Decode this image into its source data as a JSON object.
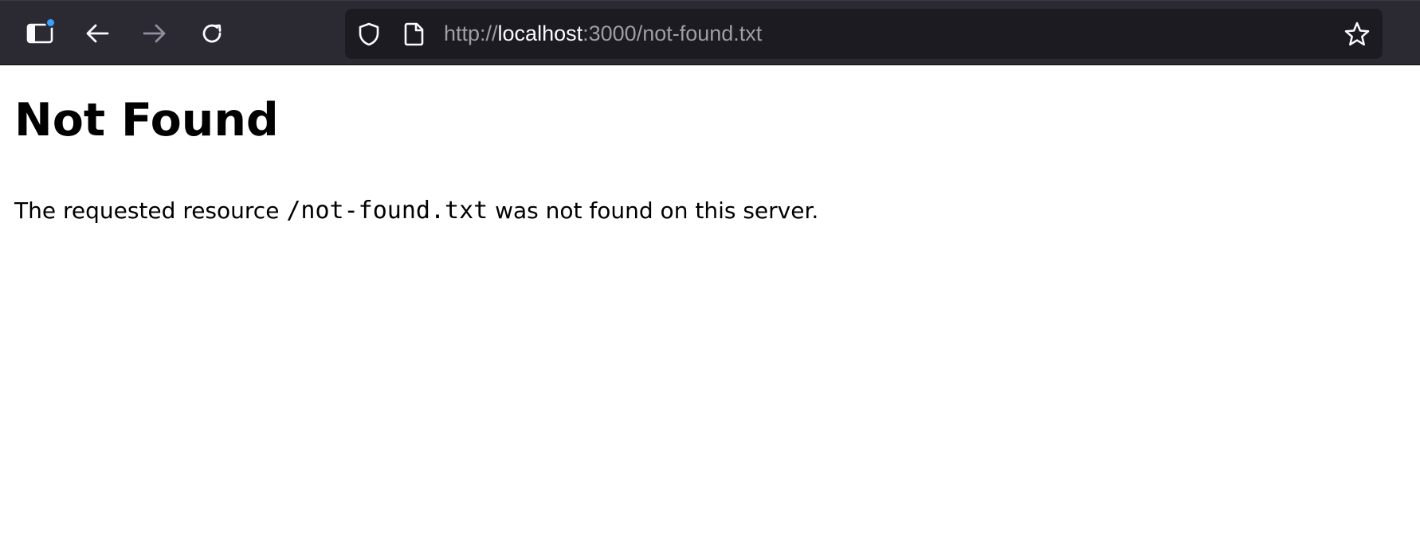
{
  "browser": {
    "url": {
      "scheme": "http://",
      "host": "localhost",
      "rest": ":3000/not-found.txt"
    },
    "icons": {
      "sidebar": "sidebar-icon",
      "back": "arrow-left-icon",
      "forward": "arrow-right-icon",
      "reload": "reload-icon",
      "shield": "shield-icon",
      "page": "page-icon",
      "bookmark": "star-icon"
    },
    "colors": {
      "toolbar": "#2b2a33",
      "urlbar": "#1c1b22",
      "badge": "#3aa0ff"
    }
  },
  "page": {
    "title": "Not Found",
    "message_before": "The requested resource ",
    "resource": "/not-found.txt",
    "message_after": " was not found on this server."
  }
}
